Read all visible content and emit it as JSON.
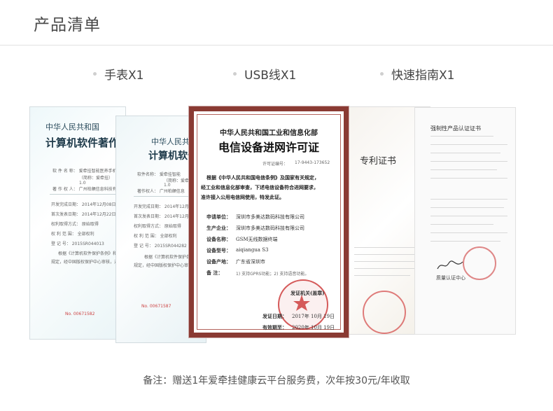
{
  "header": {
    "title": "产品清单"
  },
  "items": [
    {
      "label": "手表X1"
    },
    {
      "label": "USB线X1"
    },
    {
      "label": "快速指南X1"
    }
  ],
  "cert1": {
    "heading": "中华人民共和国",
    "title": "计算机软件著作",
    "rows": [
      "软 件 名 称：  爱牵挂智能医养手机",
      "（简称：爱牵挂）",
      "1.0",
      "著  作  权  人：  广州柏頔信息科技有限",
      "开发完成日期：  2014年12月08日",
      "首次发表日期：  2014年12月22日",
      "权利取得方式：  原始取得",
      "权 利 范 围：  全部权利",
      "登   记   号：  2015SR044013",
      "根据《计算机软件保护条例》和",
      "规定，经中国版权保护中心审核，对"
    ],
    "number": "No. 00671582"
  },
  "cert2": {
    "heading": "中华人民共",
    "title": "计算机软件",
    "rows": [
      "软件名称：  爱牵挂智能",
      "（简称：爱牵",
      "1.0",
      "著作权人：  广州柏頔信息",
      "开发完成日期：  2014年12月22日",
      "首次发表日期：  2014年12月23",
      "权利取得方式：  原始取得",
      "权 利 范 围：  全部权利",
      "登  记  号：  2015SR044282",
      "根据《计算机软件保护条例》",
      "规定，经中国版权保护中心审"
    ],
    "number": "No. 00671587"
  },
  "cert3": {
    "title": "专利证书"
  },
  "cert4": {
    "title": "强制性产品认证证书",
    "footer": "质量认证中心"
  },
  "license": {
    "top": "中华人民共和国工业和信息化部",
    "title": "电信设备进网许可证",
    "license_no_label": "许可证编号：",
    "license_no": "17-9443-173652",
    "body": [
      "根据《中华人民共和国电信条例》及国家有关规定，",
      "经工业和信息化部审查，下述电信设备符合进网要求，",
      "准许接入公用电信网使用，特发此证。"
    ],
    "fields": [
      {
        "label": "申请单位：",
        "value": "深圳市多美达数码科技有限公司"
      },
      {
        "label": "生产企业：",
        "value": "深圳市多美达数码科技有限公司"
      },
      {
        "label": "设备名称：",
        "value": "GSM无线数据终端"
      },
      {
        "label": "设备型号：",
        "value": "aiqiangua S3"
      },
      {
        "label": "设备产地：",
        "value": "广东省深圳市"
      },
      {
        "label": "备  注：",
        "value": "1) 支持GPRS功能；2) 支持语音功能。"
      }
    ],
    "issuer": "发证机关(盖章)",
    "issue_date_label": "发证日期：",
    "issue_date": "2017年  10月  19日",
    "valid_label": "有效期至：",
    "valid_date": "2020年  10月  19日"
  },
  "footer": {
    "note": "备注：赠送1年爱牵挂健康云平台服务费，次年按30元/年收取"
  },
  "colors": {
    "frame": "#8a3a33",
    "seal": "#c82828",
    "title": "#4a4a4a"
  }
}
